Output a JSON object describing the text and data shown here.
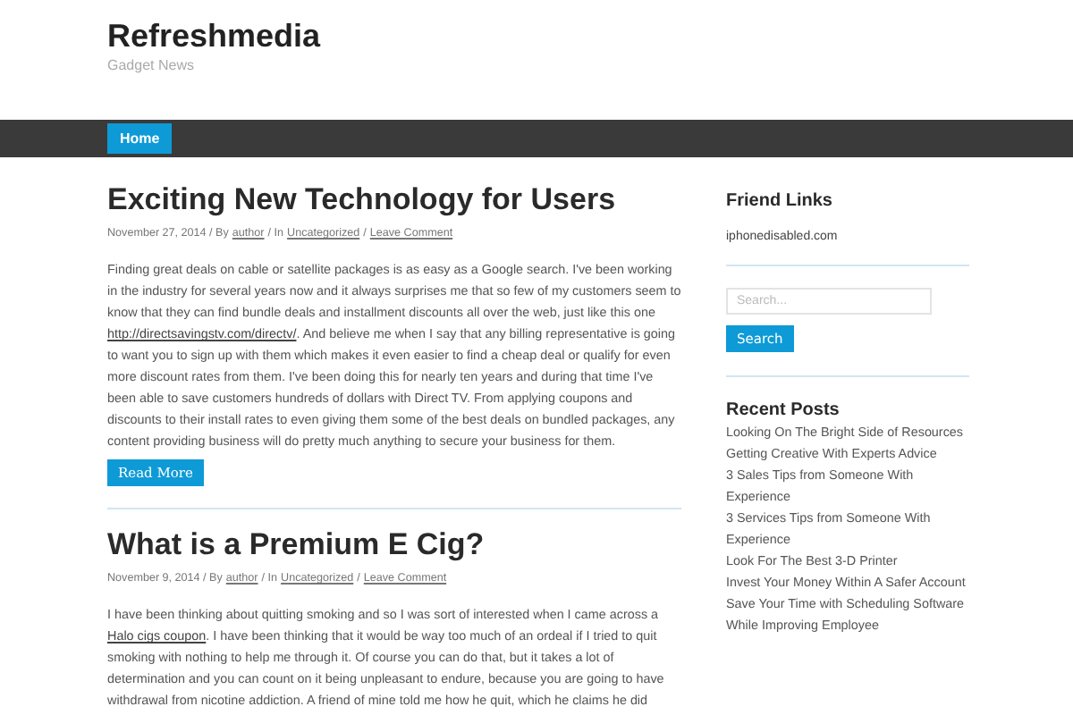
{
  "site": {
    "title": "Refreshmedia",
    "tagline": "Gadget News"
  },
  "nav": [
    {
      "label": "Home",
      "selected": true
    }
  ],
  "posts": [
    {
      "title": "Exciting New Technology for Users",
      "meta": [
        {
          "kind": "text",
          "text": "November 27, 2014 / By"
        },
        {
          "kind": "link",
          "text": "author"
        },
        {
          "kind": "text",
          "text": "/ In"
        },
        {
          "kind": "link",
          "text": "Uncategorized"
        },
        {
          "kind": "text",
          "text": "/"
        },
        {
          "kind": "link",
          "text": "Leave Comment"
        }
      ],
      "body": [
        {
          "kind": "text",
          "text": "Finding great deals on cable or satellite packages is as easy as a Google search. I've been working in the industry for several years now and it always surprises me that so few of my customers seem to know that they can find bundle deals and installment discounts all over the web, just like this one "
        },
        {
          "kind": "link",
          "text": "http://directsavingstv.com/directv/"
        },
        {
          "kind": "text",
          "text": ". And believe me when I say that any billing representative is going to want you to sign up with them which makes it even easier to find a cheap deal or qualify for even more discount rates from them. I've been doing this for nearly ten years and during that time I've been able to save customers hundreds of dollars with Direct TV. From applying coupons and discounts to their install rates to even giving them some of the best deals on bundled packages, any content providing business will do pretty much anything to secure your business for them. "
        }
      ],
      "read_more": "Read More"
    },
    {
      "title": "What is a Premium E Cig?",
      "meta": [
        {
          "kind": "text",
          "text": "November 9, 2014 / By"
        },
        {
          "kind": "link",
          "text": "author"
        },
        {
          "kind": "text",
          "text": "/ In"
        },
        {
          "kind": "link",
          "text": "Uncategorized"
        },
        {
          "kind": "text",
          "text": "/"
        },
        {
          "kind": "link",
          "text": "Leave Comment"
        }
      ],
      "body": [
        {
          "kind": "text",
          "text": "I have been thinking about quitting smoking and so I was sort of interested when I came across a "
        },
        {
          "kind": "link",
          "text": "Halo cigs coupon"
        },
        {
          "kind": "text",
          "text": ". I have been thinking that it would be way too much of an ordeal if I tried to quit smoking with nothing to help me through it. Of course you can do that, but it takes a lot of determination and you can count on it being unpleasant to endure, because you are going to have withdrawal from nicotine addiction. A friend of mine told me how he quit, which he claims he did"
        }
      ]
    }
  ],
  "sidebar": {
    "friend_links": {
      "title": "Friend Links",
      "links": [
        "iphonedisabled.com"
      ]
    },
    "search": {
      "placeholder": "Search...",
      "button": "Search"
    },
    "recent_posts": {
      "title": "Recent Posts",
      "items": [
        "Looking On The Bright Side of Resources",
        "Getting Creative With Experts Advice",
        "3 Sales Tips from Someone With Experience",
        "3 Services Tips from Someone With Experience",
        "Look For The Best 3-D Printer",
        "Invest Your Money Within A Safer Account",
        "Save Your Time with Scheduling Software While Improving Employee"
      ]
    }
  }
}
